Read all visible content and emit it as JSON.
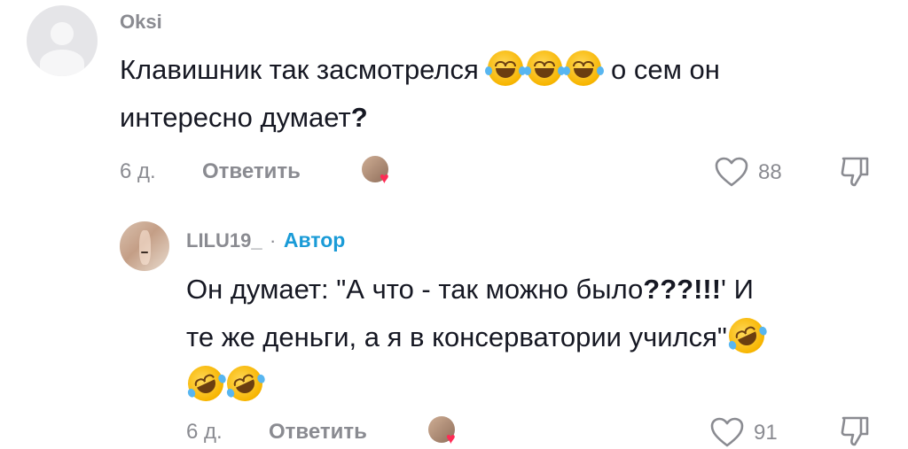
{
  "comments": [
    {
      "username": "Oksi",
      "text_parts": [
        "Клавишник так засмотрелся",
        "о сем он",
        "интересно думает",
        "?"
      ],
      "emojis": [
        "😂",
        "😂",
        "😂"
      ],
      "time": "6 д.",
      "reply_label": "Ответить",
      "like_count": "88"
    },
    {
      "username": "LILU19_",
      "separator": "·",
      "author_label": "Автор",
      "text_parts": [
        "Он думает: \"А что - так можно было",
        "???!!!",
        "' И",
        "те же деньги, а я в консерватории учился\""
      ],
      "emojis": [
        "🤣",
        "🤣",
        "🤣"
      ],
      "time": "6 д.",
      "reply_label": "Ответить",
      "like_count": "91"
    }
  ],
  "icons": {
    "like": "heart-outline-icon",
    "dislike": "thumbs-down-outline-icon",
    "creator_liked": "creator-liked-heart-icon"
  },
  "colors": {
    "author_accent": "#1a9bd7",
    "heart_accent": "#fe2c55",
    "muted_text": "#8a8b91"
  }
}
